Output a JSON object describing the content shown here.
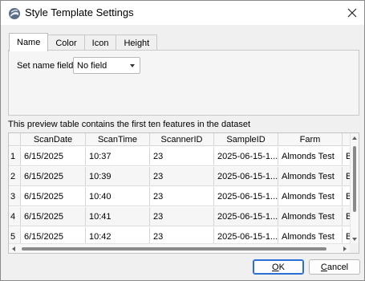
{
  "window": {
    "title": "Style Template Settings"
  },
  "tabs": [
    {
      "label": "Name",
      "active": true
    },
    {
      "label": "Color",
      "active": false
    },
    {
      "label": "Icon",
      "active": false
    },
    {
      "label": "Height",
      "active": false
    }
  ],
  "name_tab": {
    "field_label": "Set name field",
    "field_value": "No field"
  },
  "preview": {
    "note": "This preview table contains the first ten features in the dataset",
    "columns": [
      "ScanDate",
      "ScanTime",
      "ScannerID",
      "SampleID",
      "Farm",
      ""
    ],
    "rows": [
      {
        "num": "1",
        "cells": [
          "6/15/2025",
          "10:37",
          "23",
          "2025-06-15-1...",
          "Almonds Test",
          "Bl"
        ]
      },
      {
        "num": "2",
        "cells": [
          "6/15/2025",
          "10:39",
          "23",
          "2025-06-15-1...",
          "Almonds Test",
          "Bl"
        ]
      },
      {
        "num": "3",
        "cells": [
          "6/15/2025",
          "10:40",
          "23",
          "2025-06-15-1...",
          "Almonds Test",
          "Bl"
        ]
      },
      {
        "num": "4",
        "cells": [
          "6/15/2025",
          "10:41",
          "23",
          "2025-06-15-1...",
          "Almonds Test",
          "Bl"
        ]
      },
      {
        "num": "5",
        "cells": [
          "6/15/2025",
          "10:42",
          "23",
          "2025-06-15-1...",
          "Almonds Test",
          "Bl"
        ]
      }
    ]
  },
  "buttons": {
    "ok_underlined": "O",
    "ok_rest": "K",
    "cancel_underlined": "C",
    "cancel_rest": "ancel"
  },
  "icons": {
    "app": "app-logo-icon",
    "close": "close-icon",
    "dropdown": "chevron-down-icon"
  },
  "colors": {
    "accent": "#2a6fd6",
    "titlebar": "#ffffff",
    "background": "#f0f0f0"
  }
}
